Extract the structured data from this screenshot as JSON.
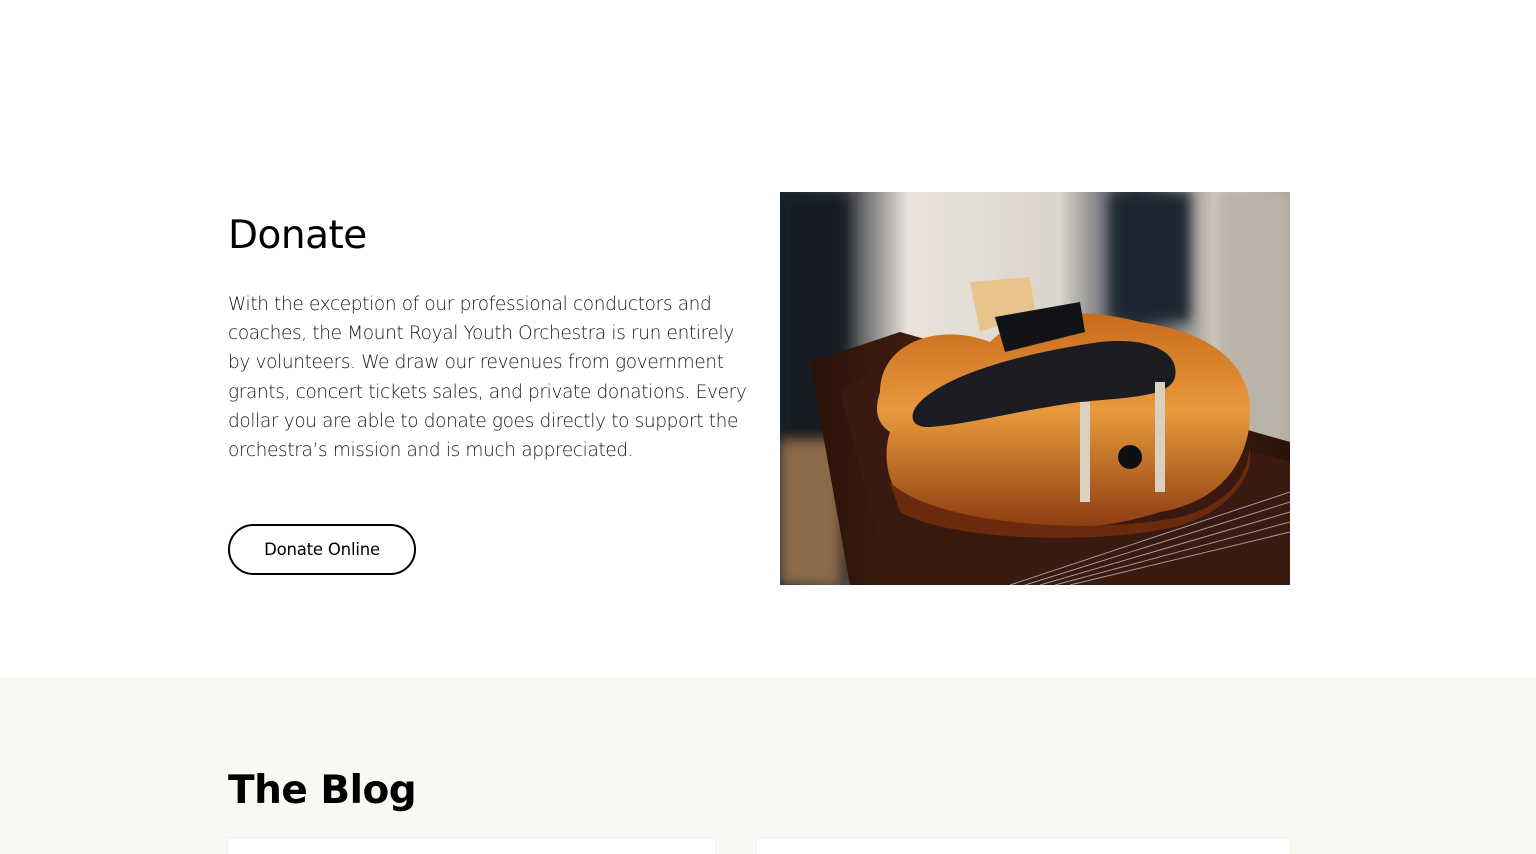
{
  "donate": {
    "title": "Donate",
    "body": "With the exception of our professional conductors and coaches, the Mount Royal Youth Orchestra is run entirely by volunteers. We draw our revenues from government grants, concert tickets sales, and private donations. Every dollar you are able to donate goes directly to support the orchestra’s mission and is much appreciated.",
    "button_label": "Donate Online",
    "image_subject": "violin"
  },
  "blog": {
    "title": "The Blog",
    "background_color": "#faf8f3"
  }
}
